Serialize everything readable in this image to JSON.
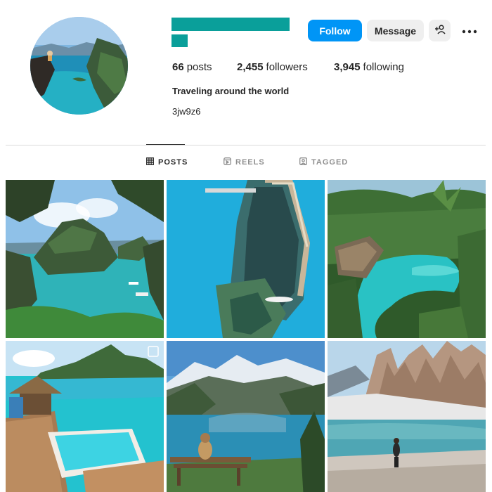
{
  "profile": {
    "avatar_icon": "profile-avatar-coastal-lake",
    "bio": "Traveling around the world",
    "handle": "3jw9z6"
  },
  "actions": {
    "follow_label": "Follow",
    "message_label": "Message",
    "suggest_icon": "add-person-icon",
    "more_icon": "more-options-icon"
  },
  "stats": {
    "posts_count": "66",
    "posts_label": "posts",
    "followers_count": "2,455",
    "followers_label": "followers",
    "following_count": "3,945",
    "following_label": "following"
  },
  "tabs": [
    {
      "label": "POSTS",
      "icon": "grid-icon",
      "active": true
    },
    {
      "label": "REELS",
      "icon": "reels-icon",
      "active": false
    },
    {
      "label": "TAGGED",
      "icon": "tagged-icon",
      "active": false
    }
  ],
  "colors": {
    "brand_accent": "#0095f6",
    "redaction": "#0a9f9a",
    "text": "#262626",
    "muted": "#8e8e8e"
  },
  "posts": [
    {
      "subject": "tropical-lagoon-limestone-cliffs"
    },
    {
      "subject": "shipwreck-turquoise-water"
    },
    {
      "subject": "jungle-resort-pools"
    },
    {
      "subject": "overwater-bungalow-pool"
    },
    {
      "subject": "alpine-lake-bench"
    },
    {
      "subject": "dolomites-glacier-lake"
    }
  ]
}
